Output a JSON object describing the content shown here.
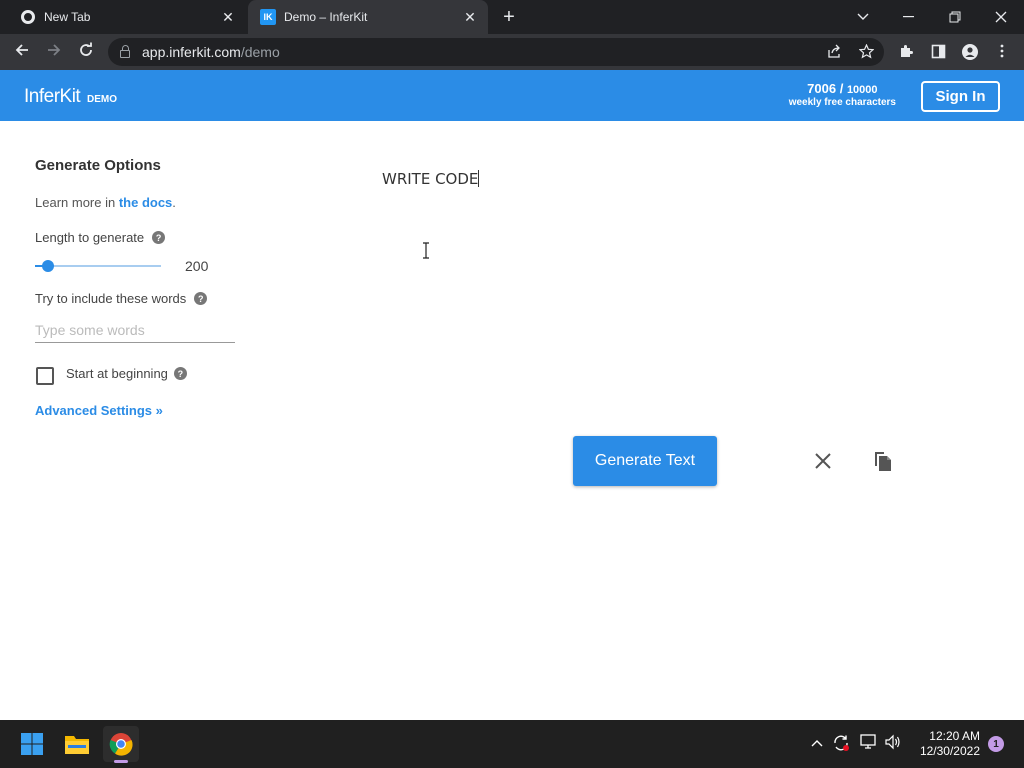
{
  "browser": {
    "tabs": [
      {
        "title": "New Tab",
        "active": false
      },
      {
        "title": "Demo – InferKit",
        "active": true
      }
    ],
    "favicon_label": "IK",
    "url_host": "app.inferkit.com",
    "url_path": "/demo"
  },
  "header": {
    "logo": "InferKit",
    "logo_badge": "DEMO",
    "credits_used": "7006",
    "credits_max": "10000",
    "credits_label": "weekly free characters",
    "sign_in": "Sign In",
    "accent_color": "#2b8ce6"
  },
  "options": {
    "title": "Generate Options",
    "learn_prefix": "Learn more in ",
    "learn_link": "the docs",
    "learn_suffix": ".",
    "length_label": "Length to generate",
    "length_value": "200",
    "length_fraction": 0.1,
    "include_label": "Try to include these words",
    "include_placeholder": "Type some words",
    "include_value": "",
    "start_label": "Start at beginning",
    "start_checked": false,
    "advanced": "Advanced Settings »",
    "help_glyph": "?"
  },
  "editor": {
    "text": "WRITE CODE",
    "generate_label": "Generate Text"
  },
  "taskbar": {
    "time": "12:20 AM",
    "date": "12/30/2022",
    "notifications": "1"
  }
}
